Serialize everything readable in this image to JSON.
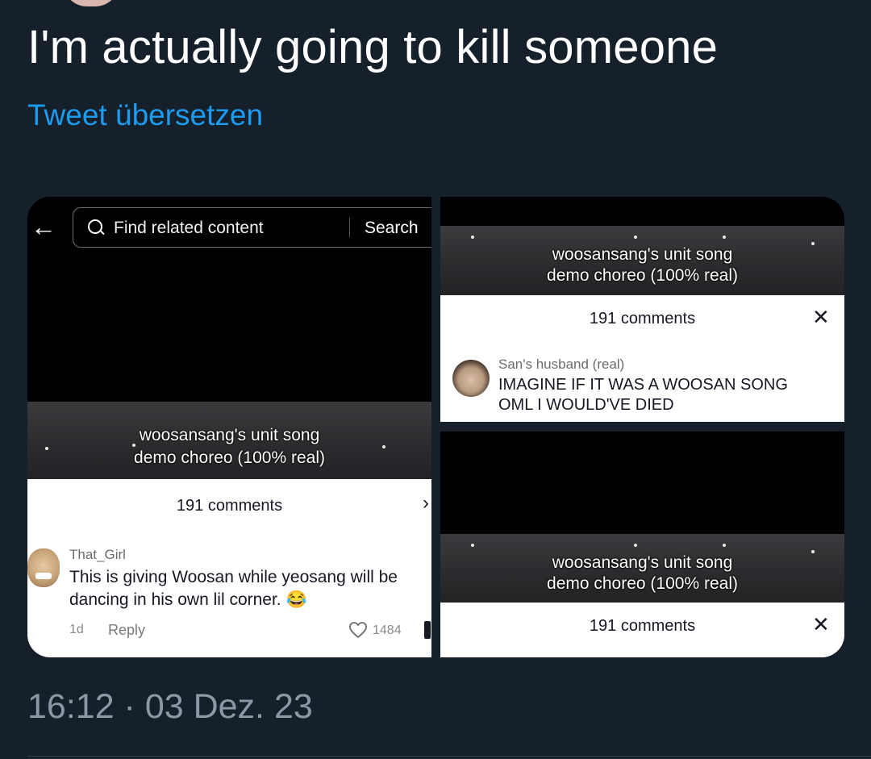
{
  "tweet": {
    "text": "I'm actually going to kill someone",
    "translate_link": "Tweet übersetzen",
    "timestamp": "16:12 · 03 Dez. 23"
  },
  "media": {
    "left": {
      "search_placeholder": "Find related content",
      "search_button": "Search",
      "caption_line1": "woosansang's unit song",
      "caption_line2": "demo choreo (100% real)",
      "comments_count": "191 comments",
      "comment": {
        "user": "That_Girl",
        "text": "This is giving Woosan while yeosang will be dancing in his own lil corner. 😂",
        "age": "1d",
        "reply": "Reply",
        "likes": "1484"
      }
    },
    "top_right": {
      "caption_line1": "woosansang's unit song",
      "caption_line2": "demo choreo (100% real)",
      "comments_count": "191 comments",
      "close": "✕",
      "comment": {
        "user": "San's husband (real)",
        "line1": "IMAGINE IF IT WAS A WOOSAN SONG",
        "line2": "OML I WOULD'VE DIED"
      }
    },
    "bottom_right": {
      "caption_line1": "woosansang's unit song",
      "caption_line2": "demo choreo (100% real)",
      "comments_count": "191 comments",
      "close": "✕"
    }
  },
  "colors": {
    "background": "#15202b",
    "link": "#1d9bf0",
    "muted": "#8b98a5"
  }
}
